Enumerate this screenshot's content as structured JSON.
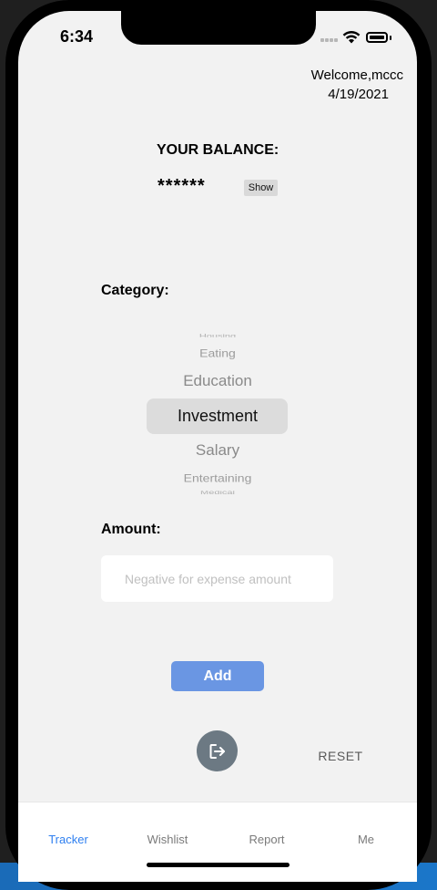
{
  "status_bar": {
    "time": "6:34"
  },
  "header": {
    "welcome": "Welcome,mccc",
    "date": "4/19/2021"
  },
  "balance": {
    "title": "YOUR BALANCE:",
    "masked_value": "******",
    "show_label": "Show"
  },
  "category": {
    "label": "Category:",
    "options": [
      "Housing",
      "Eating",
      "Education",
      "Investment",
      "Salary",
      "Entertaining",
      "Medical"
    ],
    "selected": "Investment"
  },
  "amount": {
    "label": "Amount:",
    "placeholder": "Negative for expense amount",
    "value": ""
  },
  "actions": {
    "add_label": "Add",
    "reset_label": "RESET"
  },
  "tabs": [
    {
      "label": "Tracker",
      "active": true
    },
    {
      "label": "Wishlist",
      "active": false
    },
    {
      "label": "Report",
      "active": false
    },
    {
      "label": "Me",
      "active": false
    }
  ],
  "colors": {
    "accent_blue": "#2e7ff0",
    "add_button": "#6a96e3",
    "logout_button": "#6c7983",
    "background": "#f2f2f2"
  },
  "icons": {
    "logout": "logout-icon",
    "wifi": "wifi-icon",
    "battery": "battery-icon"
  }
}
